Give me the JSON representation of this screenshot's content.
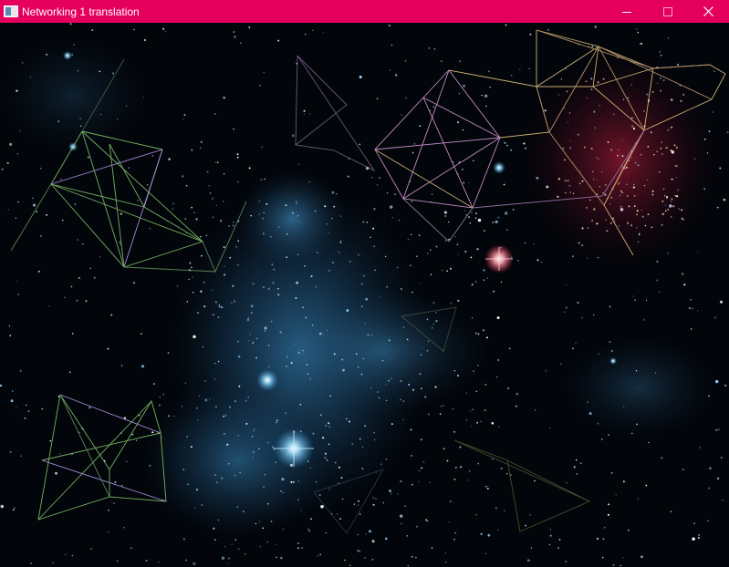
{
  "window": {
    "title": "Networking 1 translation",
    "titlebar_color": "#e5005e",
    "controls": [
      {
        "name": "minimize-button",
        "icon": "minimize-icon"
      },
      {
        "name": "maximize-button",
        "icon": "maximize-icon"
      },
      {
        "name": "close-button",
        "icon": "close-icon"
      }
    ]
  },
  "scene": {
    "background": "#02050a",
    "nebula_colors": [
      "#1c4a6e",
      "#2a6a95",
      "#8a1830"
    ],
    "line_colors": [
      "#c8a0ff",
      "#8ad070",
      "#d89ad8",
      "#e0c080",
      "#9a7ab0"
    ]
  }
}
